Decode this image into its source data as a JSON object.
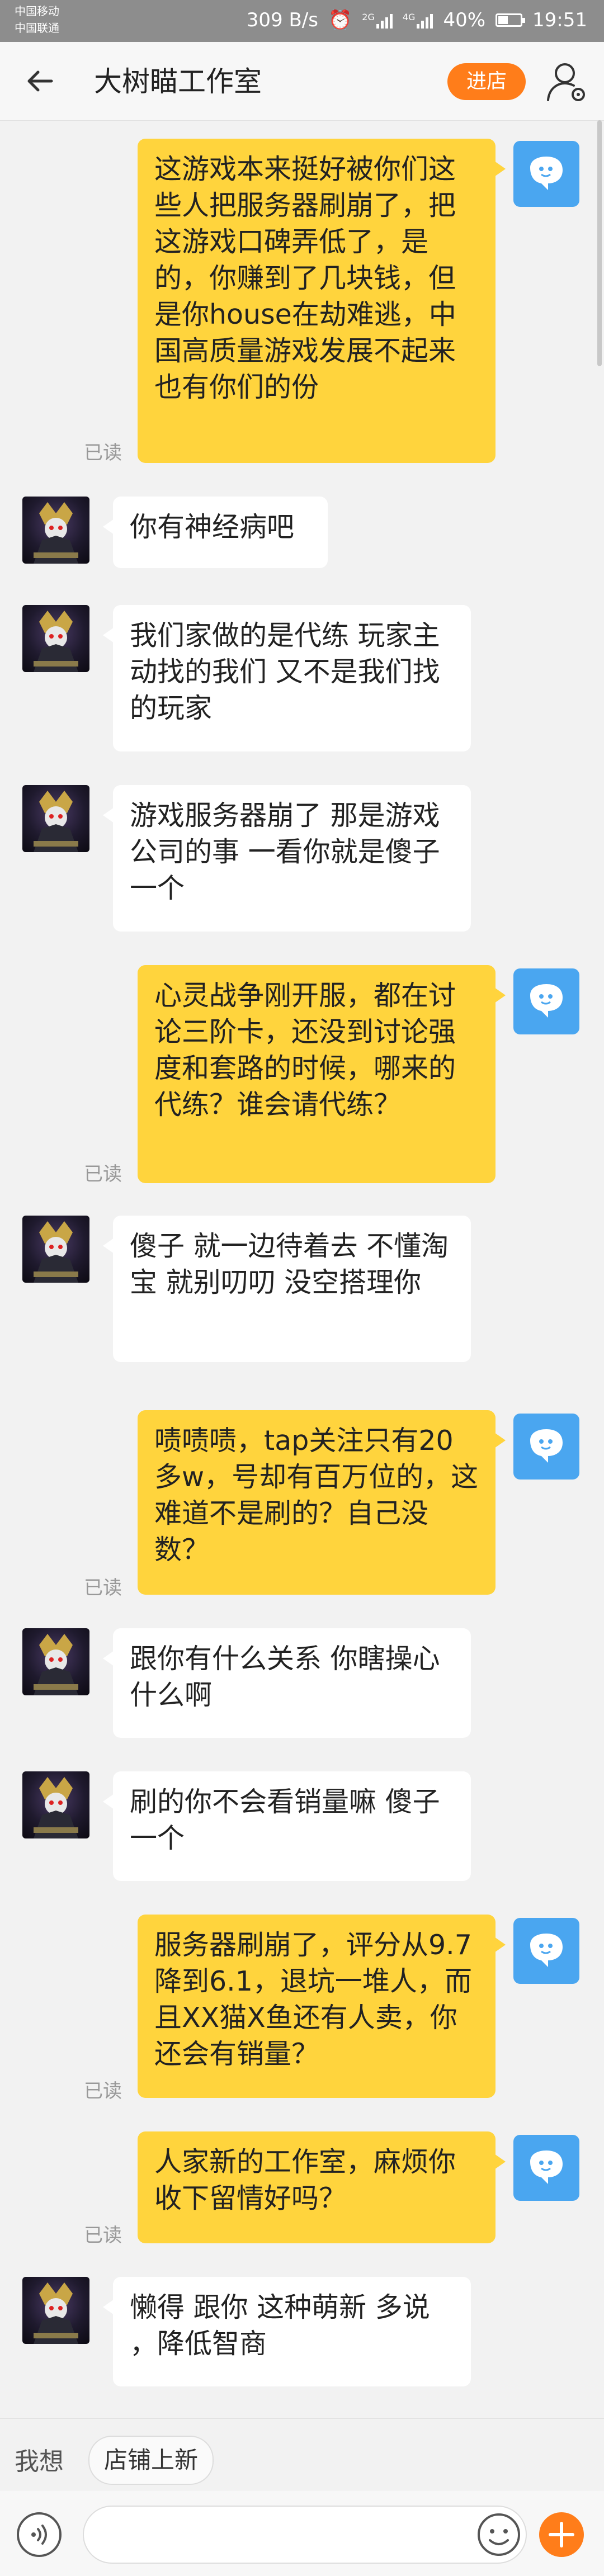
{
  "status_bar": {
    "carrier1": "中国移动",
    "carrier2": "中国联通",
    "net_speed": "309 B/s",
    "signal1_label": "2G",
    "signal2_label": "4G",
    "battery": "40%",
    "time": "19:51"
  },
  "header": {
    "title": "大树瞄工作室",
    "enter_shop_label": "进店"
  },
  "messages": [
    {
      "side": "out",
      "text": "这游戏本来挺好被你们这些人把服务器刷崩了，把这游戏口碑弄低了，是的，你赚到了几块钱，但是你house在劫难逃，中国高质量游戏发展不起来也有你们的份",
      "status": "已读"
    },
    {
      "side": "in",
      "text": "你有神经病吧"
    },
    {
      "side": "in",
      "text": "我们家做的是代练 玩家主动找的我们 又不是我们找的玩家"
    },
    {
      "side": "in",
      "text": "游戏服务器崩了 那是游戏公司的事 一看你就是傻子一个"
    },
    {
      "side": "out",
      "text": "心灵战争刚开服，都在讨论三阶卡，还没到讨论强度和套路的时候，哪来的代练？谁会请代练？",
      "status": "已读"
    },
    {
      "side": "in",
      "text": "傻子 就一边待着去 不懂淘宝 就别叨叨 没空搭理你"
    },
    {
      "side": "out",
      "text": "啧啧啧，tap关注只有20多w，号却有百万位的，这难道不是刷的？自己没数？",
      "status": "已读"
    },
    {
      "side": "in",
      "text": "跟你有什么关系 你瞎操心什么啊"
    },
    {
      "side": "in",
      "text": "刷的你不会看销量嘛 傻子一个"
    },
    {
      "side": "out",
      "text": "服务器刷崩了，评分从9.7降到6.1，退坑一堆人，而且XX猫X鱼还有人卖，你还会有销量？",
      "status": "已读"
    },
    {
      "side": "out",
      "text": "人家新的工作室，麻烦你收下留情好吗？",
      "status": "已读"
    },
    {
      "side": "in",
      "text": "懒得 跟你 这种萌新 多说 ，降低智商"
    }
  ],
  "quick_bar": {
    "label": "我想",
    "chip": "店铺上新"
  },
  "input_bar": {
    "placeholder": ""
  },
  "colors": {
    "accent": "#ff7d1a",
    "outgoing_bubble": "#ffd43d",
    "incoming_bubble": "#ffffff",
    "my_avatar": "#4aa6f0"
  }
}
